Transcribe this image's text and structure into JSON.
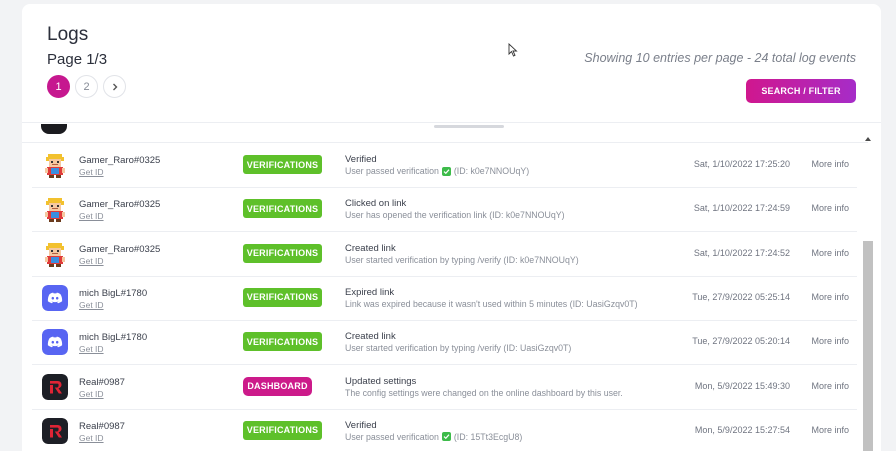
{
  "header": {
    "title": "Logs",
    "page_label": "Page 1/3",
    "showing_text": "Showing 10 entries per page - 24 total log events",
    "search_button": "SEARCH / FILTER"
  },
  "pagination": {
    "pages": [
      "1",
      "2"
    ],
    "active": "1",
    "next_icon": "chevron-right-icon"
  },
  "colors": {
    "accent": "#c6188f",
    "verifications_badge": "#5ec02a",
    "dashboard_badge": "#cc1a8a",
    "check_green": "#3dbb4a",
    "discord_blue": "#5865f2"
  },
  "logs": [
    {
      "avatar": "pixel-character",
      "username": "Gamer_Raro#0325",
      "get_id": "Get ID",
      "badge": "VERIFICATIONS",
      "event": "Verified",
      "desc_before": "User passed verification",
      "has_check": true,
      "desc_after": "(ID: k0e7NNOUqY)",
      "date": "Sat, 1/10/2022 17:25:20",
      "more": "More info"
    },
    {
      "avatar": "pixel-character",
      "username": "Gamer_Raro#0325",
      "get_id": "Get ID",
      "badge": "VERIFICATIONS",
      "event": "Clicked on link",
      "desc_before": "User has opened the verification link (ID: k0e7NNOUqY)",
      "has_check": false,
      "desc_after": "",
      "date": "Sat, 1/10/2022 17:24:59",
      "more": "More info"
    },
    {
      "avatar": "pixel-character",
      "username": "Gamer_Raro#0325",
      "get_id": "Get ID",
      "badge": "VERIFICATIONS",
      "event": "Created link",
      "desc_before": "User started verification by typing /verify (ID: k0e7NNOUqY)",
      "has_check": false,
      "desc_after": "",
      "date": "Sat, 1/10/2022 17:24:52",
      "more": "More info"
    },
    {
      "avatar": "discord",
      "username": "mich BigL#1780",
      "get_id": "Get ID",
      "badge": "VERIFICATIONS",
      "event": "Expired link",
      "desc_before": "Link was expired because it wasn't used within 5 minutes (ID: UasiGzqv0T)",
      "has_check": false,
      "desc_after": "",
      "date": "Tue, 27/9/2022 05:25:14",
      "more": "More info"
    },
    {
      "avatar": "discord",
      "username": "mich BigL#1780",
      "get_id": "Get ID",
      "badge": "VERIFICATIONS",
      "event": "Created link",
      "desc_before": "User started verification by typing /verify (ID: UasiGzqv0T)",
      "has_check": false,
      "desc_after": "",
      "date": "Tue, 27/9/2022 05:20:14",
      "more": "More info"
    },
    {
      "avatar": "red-r-logo",
      "username": "Real#0987",
      "get_id": "Get ID",
      "badge": "DASHBOARD",
      "event": "Updated settings",
      "desc_before": "The config settings were changed on the online dashboard by this user.",
      "has_check": false,
      "desc_after": "",
      "date": "Mon, 5/9/2022 15:49:30",
      "more": "More info"
    },
    {
      "avatar": "red-r-logo",
      "username": "Real#0987",
      "get_id": "Get ID",
      "badge": "VERIFICATIONS",
      "event": "Verified",
      "desc_before": "User passed verification",
      "has_check": true,
      "desc_after": "(ID: 15Tt3EcgU8)",
      "date": "Mon, 5/9/2022 15:27:54",
      "more": "More info"
    }
  ]
}
